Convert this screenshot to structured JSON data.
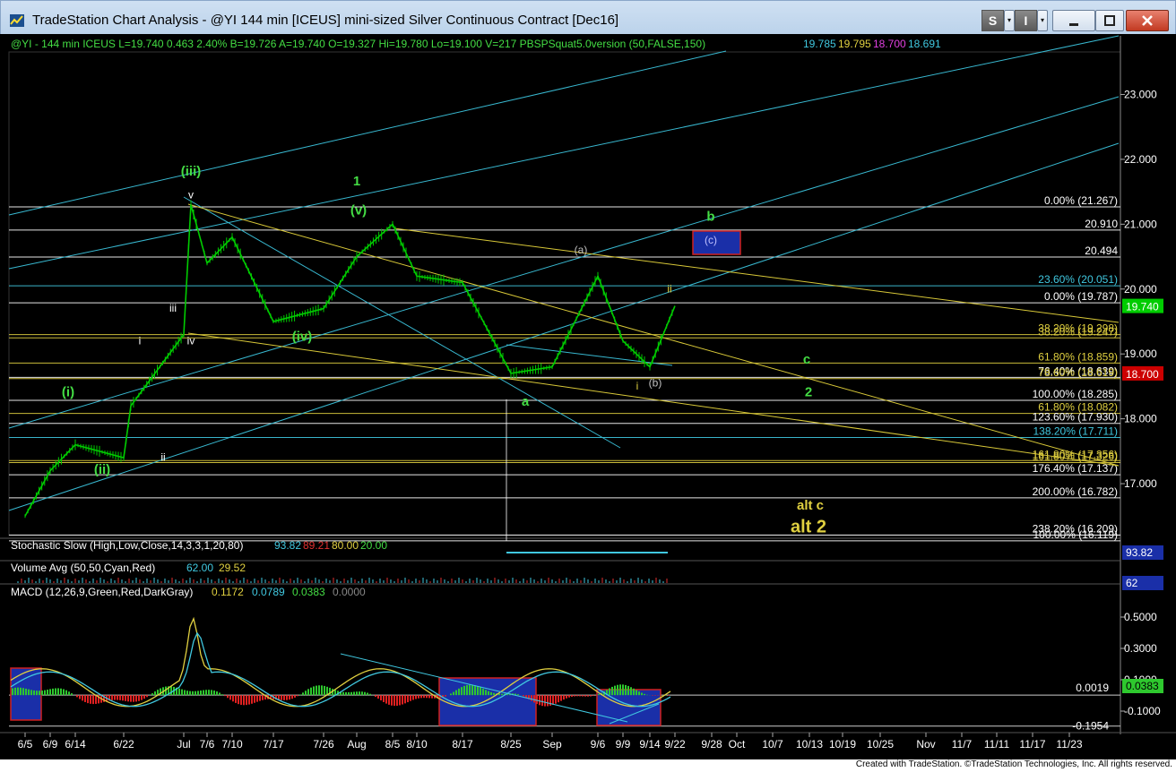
{
  "window": {
    "title": "TradeStation Chart Analysis - @YI 144 min [ICEUS] mini-sized Silver Continuous Contract [Dec16]",
    "s_label": "S",
    "i_label": "I",
    "minimize_icon": "minimize-icon",
    "maximize_icon": "maximize-icon",
    "close_icon": "close-icon"
  },
  "header": {
    "symbol_line": "@YI - 144 min  ICEUS  L=19.740  0.463  2.40%  B=19.726  A=19.740  O=19.327  Hi=19.780  Lo=19.100  V=217  PBSPSquat5.0version (50,FALSE,150)",
    "indicator_values": [
      "19.785",
      "19.795",
      "18.700",
      "18.691"
    ],
    "indicator_colors": [
      "#40c8e0",
      "#e0d040",
      "#e040e0",
      "#40c8e0"
    ]
  },
  "footer": {
    "credit": "Created with TradeStation. ©TradeStation Technologies, Inc. All rights reserved."
  },
  "chart_data": [
    {
      "type": "line",
      "panel": "price",
      "x_tick_labels": [
        "6/5",
        "6/9",
        "6/14",
        "6/22",
        "Jul",
        "7/6",
        "7/10",
        "7/17",
        "7/26",
        "Aug",
        "8/5",
        "8/10",
        "8/17",
        "8/25",
        "Sep",
        "9/6",
        "9/9",
        "9/14",
        "9/22",
        "9/28",
        "Oct",
        "10/7",
        "10/13",
        "10/19",
        "10/25",
        "Nov",
        "11/7",
        "11/11",
        "11/17",
        "11/23"
      ],
      "y_tick_labels": [
        "23.000",
        "22.000",
        "21.000",
        "20.000",
        "19.000",
        "18.000",
        "17.000"
      ],
      "ylim": [
        16.2,
        23.6
      ],
      "last_price_label": "19.740",
      "last_price_color": "#00cc00",
      "low_price_label": "18.700",
      "low_price_color": "#cc0000",
      "series": [
        {
          "color": "#00cc00",
          "points": [
            [
              "6/5",
              16.5
            ],
            [
              "6/9",
              17.2
            ],
            [
              "6/14",
              17.6
            ],
            [
              "6/22",
              17.4
            ],
            [
              "6/22",
              18.2
            ],
            [
              "Jul",
              19.3
            ],
            [
              "Jul",
              21.3
            ],
            [
              "7/6",
              20.4
            ],
            [
              "7/10",
              20.8
            ],
            [
              "7/17",
              19.5
            ],
            [
              "7/26",
              19.7
            ],
            [
              "Aug",
              20.5
            ],
            [
              "8/5",
              21.0
            ],
            [
              "8/10",
              20.2
            ],
            [
              "8/17",
              20.1
            ],
            [
              "8/25",
              18.7
            ],
            [
              "Sep",
              18.8
            ],
            [
              "9/6",
              20.2
            ],
            [
              "9/9",
              19.2
            ],
            [
              "9/14",
              18.8
            ],
            [
              "9/22",
              19.74
            ]
          ]
        }
      ],
      "fib_levels": [
        {
          "label": "0.00% (21.267)",
          "value": 21.267,
          "color": "#ffffff"
        },
        {
          "label": "20.910",
          "value": 20.91,
          "color": "#ffffff"
        },
        {
          "label": "20.494",
          "value": 20.494,
          "color": "#ffffff"
        },
        {
          "label": "23.60% (20.051)",
          "value": 20.051,
          "color": "#40c8e0"
        },
        {
          "label": "0.00% (19.787)",
          "value": 19.787,
          "color": "#ffffff"
        },
        {
          "label": "38.20% (19.298)",
          "value": 19.298,
          "color": "#e0d040"
        },
        {
          "label": "38.20% (19.247)",
          "value": 19.247,
          "color": "#e0d040"
        },
        {
          "label": "61.80% (18.859)",
          "value": 18.859,
          "color": "#e0d040"
        },
        {
          "label": "76.40% (18.639)",
          "value": 18.639,
          "color": "#ffffff"
        },
        {
          "label": "78.60% (18.619)",
          "value": 18.619,
          "color": "#e0d040"
        },
        {
          "label": "100.00% (18.285)",
          "value": 18.285,
          "color": "#ffffff"
        },
        {
          "label": "61.80% (18.082)",
          "value": 18.082,
          "color": "#e0d040"
        },
        {
          "label": "123.60% (17.930)",
          "value": 17.93,
          "color": "#ffffff"
        },
        {
          "label": "138.20% (17.711)",
          "value": 17.711,
          "color": "#40c8e0"
        },
        {
          "label": "161.80% (17.356)",
          "value": 17.356,
          "color": "#e0d040"
        },
        {
          "label": "161.80% (17.326)",
          "value": 17.326,
          "color": "#e0d040"
        },
        {
          "label": "176.40% (17.137)",
          "value": 17.137,
          "color": "#ffffff"
        },
        {
          "label": "200.00% (16.782)",
          "value": 16.782,
          "color": "#ffffff"
        },
        {
          "label": "238.20% (16.209)",
          "value": 16.209,
          "color": "#ffffff"
        },
        {
          "label": "100.00% (16.119)",
          "value": 16.119,
          "color": "#ffffff"
        }
      ],
      "wave_labels": [
        {
          "text": "(iii)",
          "x": "Jul",
          "y": 21.75,
          "color": "#44dd44"
        },
        {
          "text": "1",
          "x": "Aug",
          "y": 21.6,
          "color": "#44dd44"
        },
        {
          "text": "(v)",
          "x": "Aug",
          "y": 21.15,
          "color": "#44dd44"
        },
        {
          "text": "v",
          "x": "Jul",
          "y": 21.4,
          "color": "#ffffff"
        },
        {
          "text": "(i)",
          "x": "6/9",
          "y": 18.35,
          "color": "#44dd44"
        },
        {
          "text": "(ii)",
          "x": "6/14",
          "y": 17.15,
          "color": "#44dd44"
        },
        {
          "text": "(iv)",
          "x": "7/17",
          "y": 19.2,
          "color": "#44dd44"
        },
        {
          "text": "iii",
          "x": "Jul",
          "y": 19.65,
          "color": "#ffffff"
        },
        {
          "text": "iv",
          "x": "Jul",
          "y": 19.15,
          "color": "#ffffff"
        },
        {
          "text": "i",
          "x": "6/22",
          "y": 19.15,
          "color": "#ffffff"
        },
        {
          "text": "ii",
          "x": "6/22",
          "y": 17.35,
          "color": "#ffffff"
        },
        {
          "text": "b",
          "x": "9/22",
          "y": 21.05,
          "color": "#44dd44"
        },
        {
          "text": "(c)",
          "x": "9/22",
          "y": 20.7,
          "color": "#c0c0ff"
        },
        {
          "text": "(a)",
          "x": "Sep",
          "y": 20.55,
          "color": "#c0c0c0"
        },
        {
          "text": "ii",
          "x": "9/22",
          "y": 19.95,
          "color": "#e0d040"
        },
        {
          "text": "c",
          "x": "10/7",
          "y": 18.85,
          "color": "#44dd44"
        },
        {
          "text": "2",
          "x": "10/7",
          "y": 18.35,
          "color": "#44dd44"
        },
        {
          "text": "a",
          "x": "8/25",
          "y": 18.2,
          "color": "#44dd44"
        },
        {
          "text": "i",
          "x": "9/14",
          "y": 18.45,
          "color": "#e0d040"
        },
        {
          "text": "(b)",
          "x": "9/14",
          "y": 18.5,
          "color": "#c0c0c0"
        },
        {
          "text": "alt c",
          "x": "10/7",
          "y": 16.6,
          "color": "#e0d040"
        },
        {
          "text": "alt 2",
          "x": "10/7",
          "y": 16.25,
          "color": "#e0d040"
        }
      ]
    },
    {
      "type": "line",
      "panel": "stochastic",
      "legend": "Stochastic Slow (High,Low,Close,14,3,3,1,20,80)",
      "values": [
        "93.82",
        "89.21",
        "80.00",
        "20.00"
      ],
      "value_colors": [
        "#40c8e0",
        "#e03030",
        "#e0d040",
        "#44dd44"
      ],
      "axis_label": "93.82"
    },
    {
      "type": "bar",
      "panel": "volume",
      "legend": "Volume Avg (50,50,Cyan,Red)",
      "values": [
        "62.00",
        "29.52"
      ],
      "value_colors": [
        "#40c8e0",
        "#e0d040"
      ],
      "axis_label": "62"
    },
    {
      "type": "line",
      "panel": "macd",
      "legend": "MACD (12,26,9,Green,Red,DarkGray)",
      "values": [
        "0.1172",
        "0.0789",
        "0.0383",
        "0.0000"
      ],
      "value_colors": [
        "#e0d040",
        "#40c8e0",
        "#44dd44",
        "#888888"
      ],
      "y_tick_labels": [
        "0.5000",
        "0.3000",
        "0.1000",
        "-0.1000"
      ],
      "ylim": [
        -0.22,
        0.62
      ],
      "level_labels": [
        "0.0019",
        "-0.1954"
      ],
      "axis_label": "0.0383"
    }
  ]
}
